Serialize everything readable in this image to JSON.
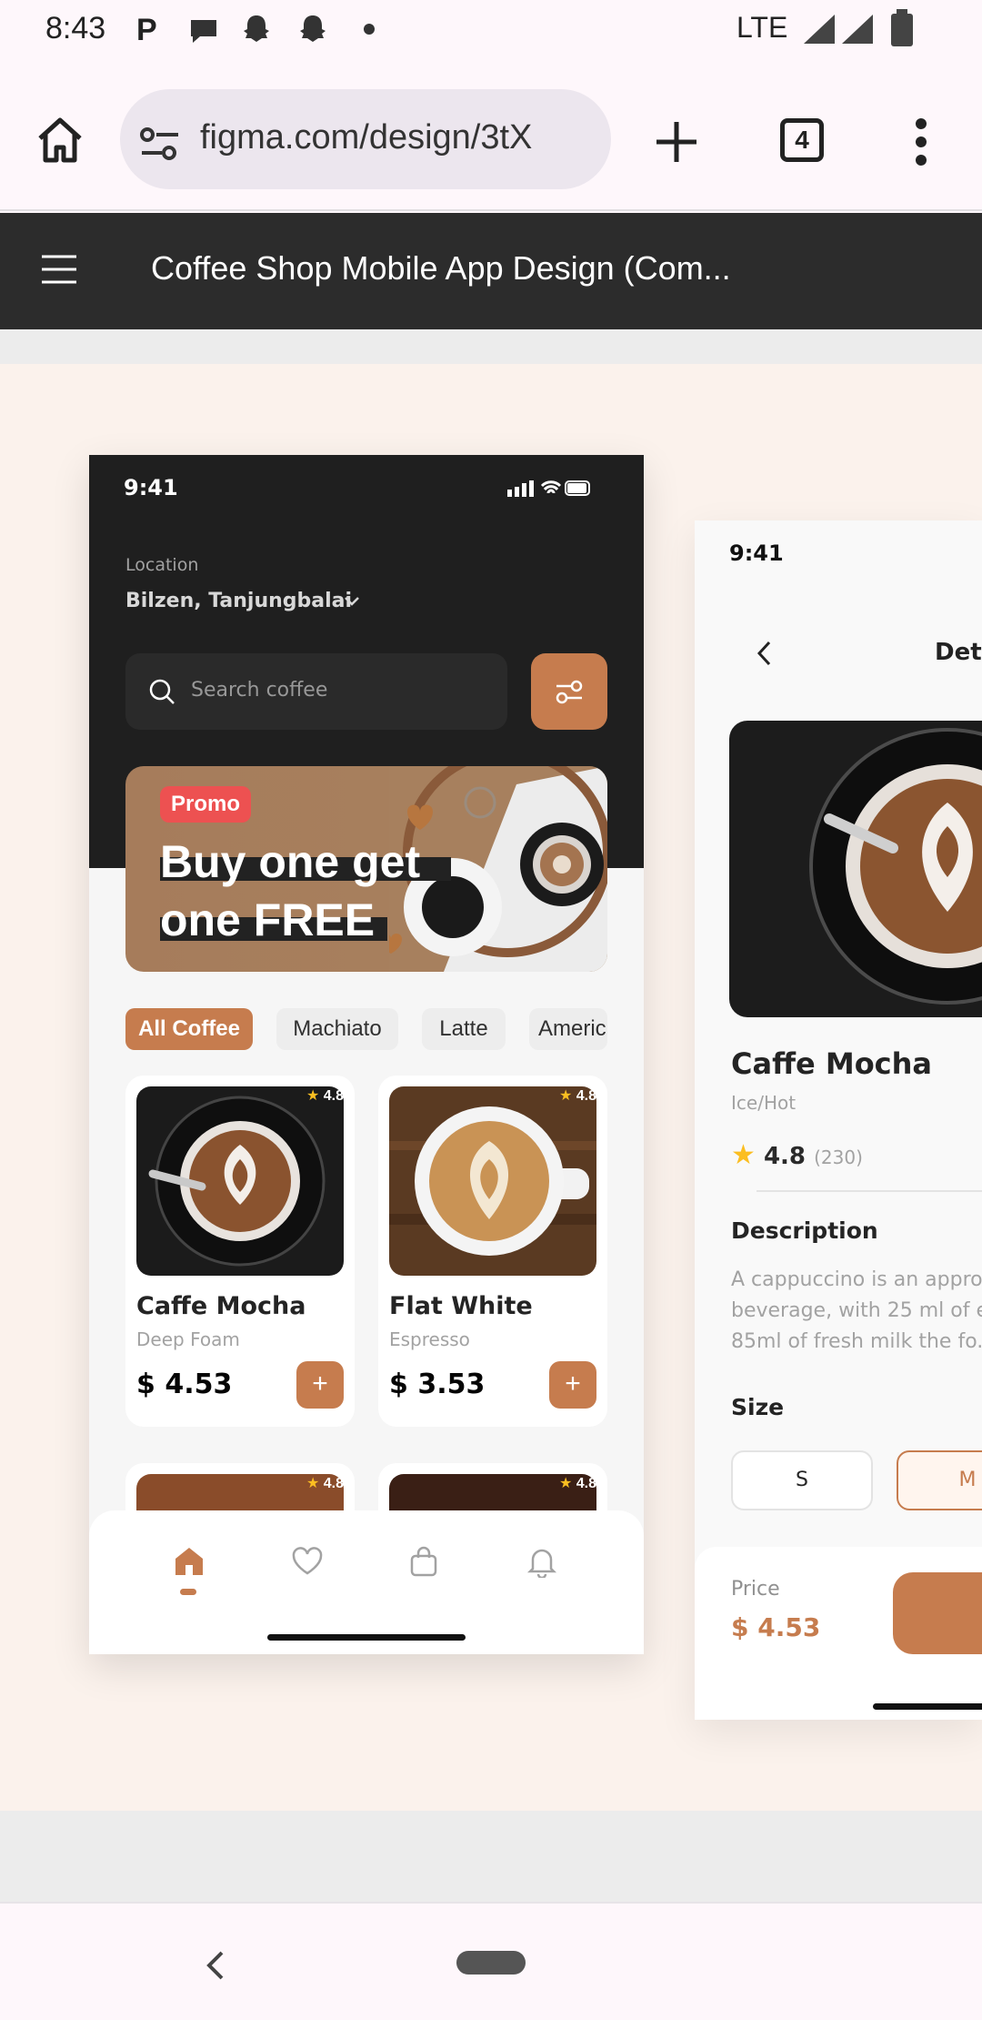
{
  "status_bar": {
    "time": "8:43",
    "network": "LTE"
  },
  "browser": {
    "url": "figma.com/design/3tX",
    "tab_count": "4"
  },
  "figma": {
    "file_title": "Coffee Shop Mobile App Design (Com..."
  },
  "home_screen": {
    "time": "9:41",
    "location_label": "Location",
    "location_value": "Bilzen, Tanjungbalai",
    "search_placeholder": "Search coffee",
    "promo": {
      "badge": "Promo",
      "line1": "Buy one get",
      "line2": "one FREE"
    },
    "categories": [
      "All Coffee",
      "Machiato",
      "Latte",
      "Americ"
    ],
    "products": [
      {
        "name": "Caffe Mocha",
        "sub": "Deep Foam",
        "price": "$ 4.53",
        "rating": "4.8"
      },
      {
        "name": "Flat White",
        "sub": "Espresso",
        "price": "$ 3.53",
        "rating": "4.8"
      }
    ],
    "more_ratings": [
      "4.8",
      "4.8"
    ],
    "plus_label": "+"
  },
  "detail_screen": {
    "time": "9:41",
    "header_title": "Deta",
    "name": "Caffe Mocha",
    "sub": "Ice/Hot",
    "rating": "4.8",
    "reviews": "(230)",
    "description_title": "Description",
    "description_lines": [
      "A cappuccino is an appro",
      "beverage, with 25 ml of e",
      "85ml of fresh milk the fo."
    ],
    "size_title": "Size",
    "sizes": [
      "S",
      "M"
    ],
    "price_label": "Price",
    "price_value": "$ 4.53"
  },
  "colors": {
    "accent": "#c67c4e",
    "dark": "#1f1f1f",
    "canvas": "#fbf2ec",
    "promo_red": "#ed5151"
  }
}
